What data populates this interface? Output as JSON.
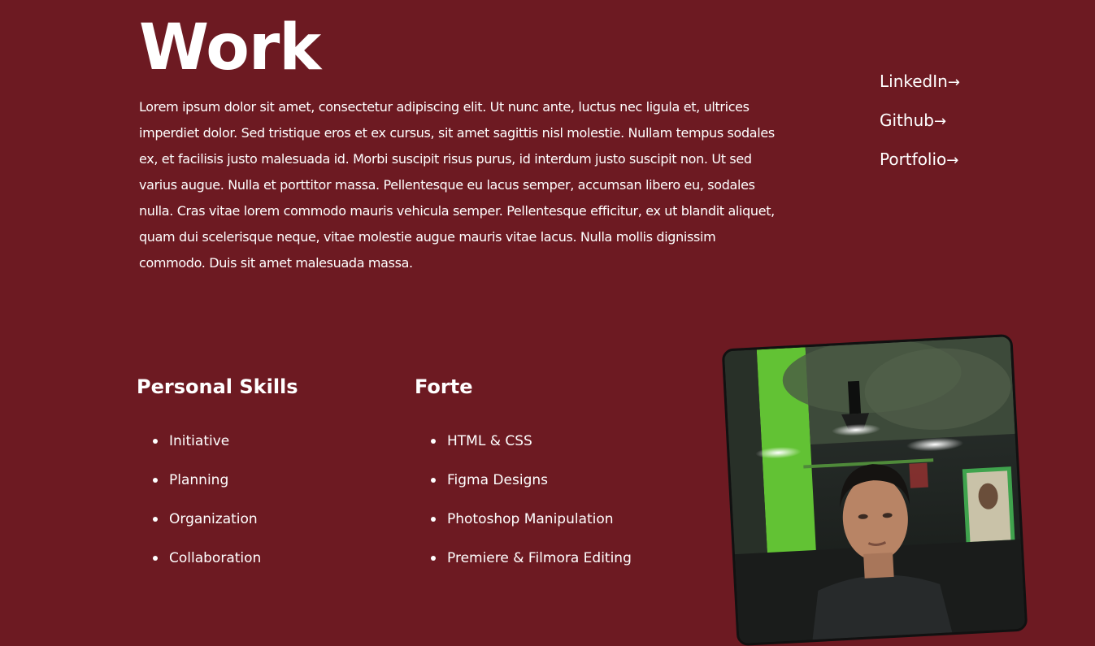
{
  "work": {
    "heading": "Work",
    "intro": "Lorem ipsum dolor sit amet, consectetur adipiscing elit. Ut nunc ante, luctus nec ligula et, ultrices imperdiet dolor. Sed tristique eros et ex cursus, sit amet sagittis nisl molestie. Nullam tempus sodales ex, et facilisis justo malesuada id. Morbi suscipit risus purus, id interdum justo suscipit non. Ut sed varius augue. Nulla et porttitor massa. Pellentesque eu lacus semper, accumsan libero eu, sodales nulla. Cras vitae lorem commodo mauris vehicula semper. Pellentesque efficitur, ex ut blandit aliquet, quam dui scelerisque neque, vitae molestie augue mauris vitae lacus. Nulla mollis dignissim commodo. Duis sit amet malesuada massa."
  },
  "social_links": [
    {
      "label": "LinkedIn",
      "arrow": "→"
    },
    {
      "label": "Github",
      "arrow": "→"
    },
    {
      "label": "Portfolio",
      "arrow": "→"
    }
  ],
  "personal_skills": {
    "title": "Personal Skills",
    "items": [
      "Initiative",
      "Planning",
      "Organization",
      "Collaboration"
    ]
  },
  "forte": {
    "title": "Forte",
    "items": [
      "HTML & CSS",
      "Figma Designs",
      "Photoshop Manipulation",
      "Premiere & Filmora Editing"
    ]
  },
  "colors": {
    "background": "#6d1a22",
    "text": "#ffffff",
    "accent_green": "#6fd13a"
  }
}
